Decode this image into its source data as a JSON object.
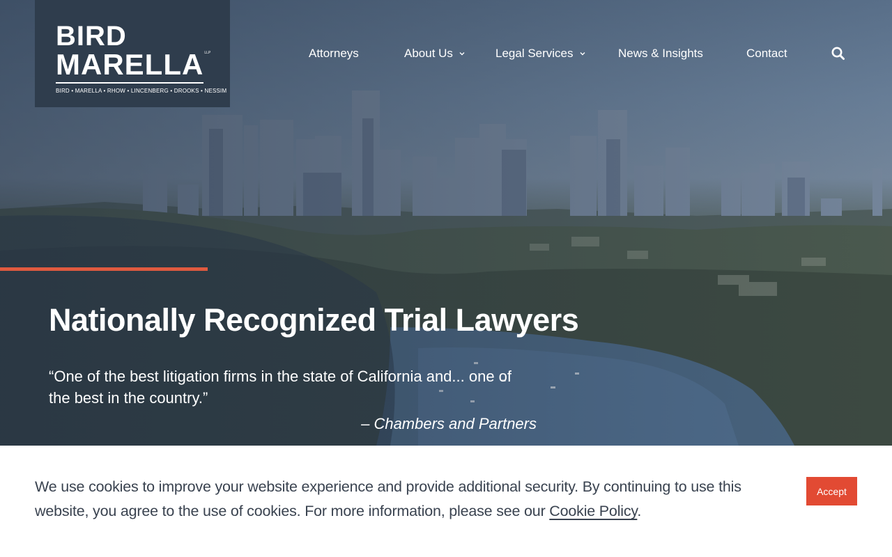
{
  "brand": {
    "name_line1": "BIRD",
    "name_line2": "MARELLA",
    "suffix": "LLP",
    "partners": "BIRD • MARELLA • RHOW • LINCENBERG • DROOKS • NESSIM",
    "panel_color": "#2f3d4d"
  },
  "nav": {
    "items": [
      {
        "label": "Attorneys",
        "has_dropdown": false
      },
      {
        "label": "About Us",
        "has_dropdown": true
      },
      {
        "label": "Legal Services",
        "has_dropdown": true
      },
      {
        "label": "News & Insights",
        "has_dropdown": false
      },
      {
        "label": "Contact",
        "has_dropdown": false
      }
    ],
    "search_icon": "search-icon"
  },
  "hero": {
    "headline": "Nationally Recognized Trial Lawyers",
    "quote": "“One of the best litigation firms in the state of California and... one of the best in the country.”",
    "attribution": "– Chambers and Partners",
    "accent_color": "#e05a3f"
  },
  "cookie_banner": {
    "text_before_link": "We use cookies to improve your website experience and provide additional security. By continuing to use this website, you agree to the use of cookies. For more information, please see our ",
    "link_text": "Cookie Policy",
    "text_after_link": ".",
    "accept_label": "Accept",
    "button_color": "#e24a33"
  }
}
